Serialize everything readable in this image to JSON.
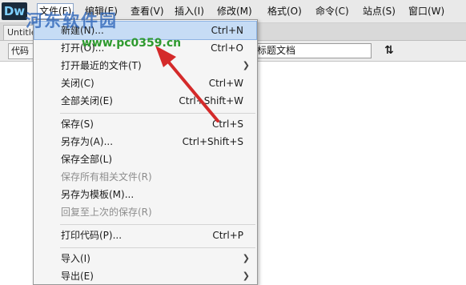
{
  "app": {
    "logo_text": "Dw"
  },
  "menubar": {
    "items": [
      {
        "label": "文件(F)"
      },
      {
        "label": "编辑(E)"
      },
      {
        "label": "查看(V)"
      },
      {
        "label": "插入(I)"
      },
      {
        "label": "修改(M)"
      },
      {
        "label": "格式(O)"
      },
      {
        "label": "命令(C)"
      },
      {
        "label": "站点(S)"
      },
      {
        "label": "窗口(W)"
      }
    ]
  },
  "watermark": {
    "site_name": "河东软件园",
    "url": "www.pc0359.cn"
  },
  "tabs": {
    "active_tab": "Untitle"
  },
  "toolbar": {
    "code_button": "代码",
    "title_value": "标题文档",
    "sort_icon": "sort-icon"
  },
  "file_menu": {
    "items": [
      {
        "label": "新建(N)...",
        "shortcut": "Ctrl+N"
      },
      {
        "label": "打开(O)...",
        "shortcut": "Ctrl+O"
      },
      {
        "label": "打开最近的文件(T)",
        "shortcut": ""
      },
      {
        "label": "关闭(C)",
        "shortcut": "Ctrl+W"
      },
      {
        "label": "全部关闭(E)",
        "shortcut": "Ctrl+Shift+W"
      },
      {
        "label": "保存(S)",
        "shortcut": "Ctrl+S"
      },
      {
        "label": "另存为(A)...",
        "shortcut": "Ctrl+Shift+S"
      },
      {
        "label": "保存全部(L)",
        "shortcut": ""
      },
      {
        "label": "保存所有相关文件(R)",
        "shortcut": ""
      },
      {
        "label": "另存为模板(M)...",
        "shortcut": ""
      },
      {
        "label": "回复至上次的保存(R)",
        "shortcut": ""
      },
      {
        "label": "打印代码(P)...",
        "shortcut": "Ctrl+P"
      },
      {
        "label": "导入(I)",
        "shortcut": ""
      },
      {
        "label": "导出(E)",
        "shortcut": ""
      }
    ]
  },
  "colors": {
    "highlight": "#c6dcf5",
    "arrow": "#d42a2a",
    "watermark_blue": "#2a63b8",
    "watermark_green": "#2e9a2e"
  }
}
